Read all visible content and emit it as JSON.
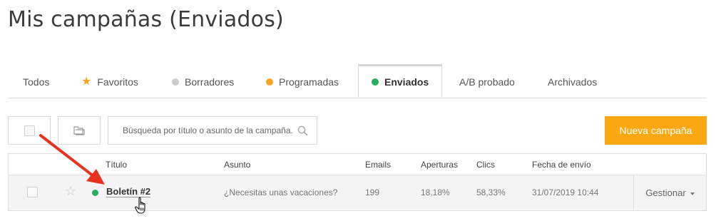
{
  "page": {
    "title": "Mis campañas (Enviados)"
  },
  "tabs": [
    {
      "label": "Todos",
      "marker": "none"
    },
    {
      "label": "Favoritos",
      "marker": "star-icon",
      "color": "#f5a623"
    },
    {
      "label": "Borradores",
      "marker": "dot",
      "color": "#cccccc"
    },
    {
      "label": "Programadas",
      "marker": "dot",
      "color": "#f5a623"
    },
    {
      "label": "Enviados",
      "marker": "dot",
      "color": "#27ae60",
      "active": true
    },
    {
      "label": "A/B probado",
      "marker": "none"
    },
    {
      "label": "Archivados",
      "marker": "none"
    }
  ],
  "toolbar": {
    "search_placeholder": "Búsqueda por título o asunto de la campaña.",
    "new_campaign_label": "Nueva campaña",
    "accent_color": "#fba712"
  },
  "table": {
    "headers": {
      "title": "Título",
      "subject": "Asunto",
      "emails": "Emails",
      "opens": "Aperturas",
      "clicks": "Clics",
      "sent_date": "Fecha de envío"
    },
    "rows": [
      {
        "status_color": "#27ae60",
        "title": "Boletín #2",
        "subject": "¿Necesitas unas vacaciones?",
        "emails": "199",
        "opens": "18,18%",
        "clicks": "58,33%",
        "sent_date": "31/07/2019 10:44",
        "manage_label": "Gestionar"
      }
    ]
  },
  "annotation": {
    "arrow_color": "#e8321e"
  }
}
